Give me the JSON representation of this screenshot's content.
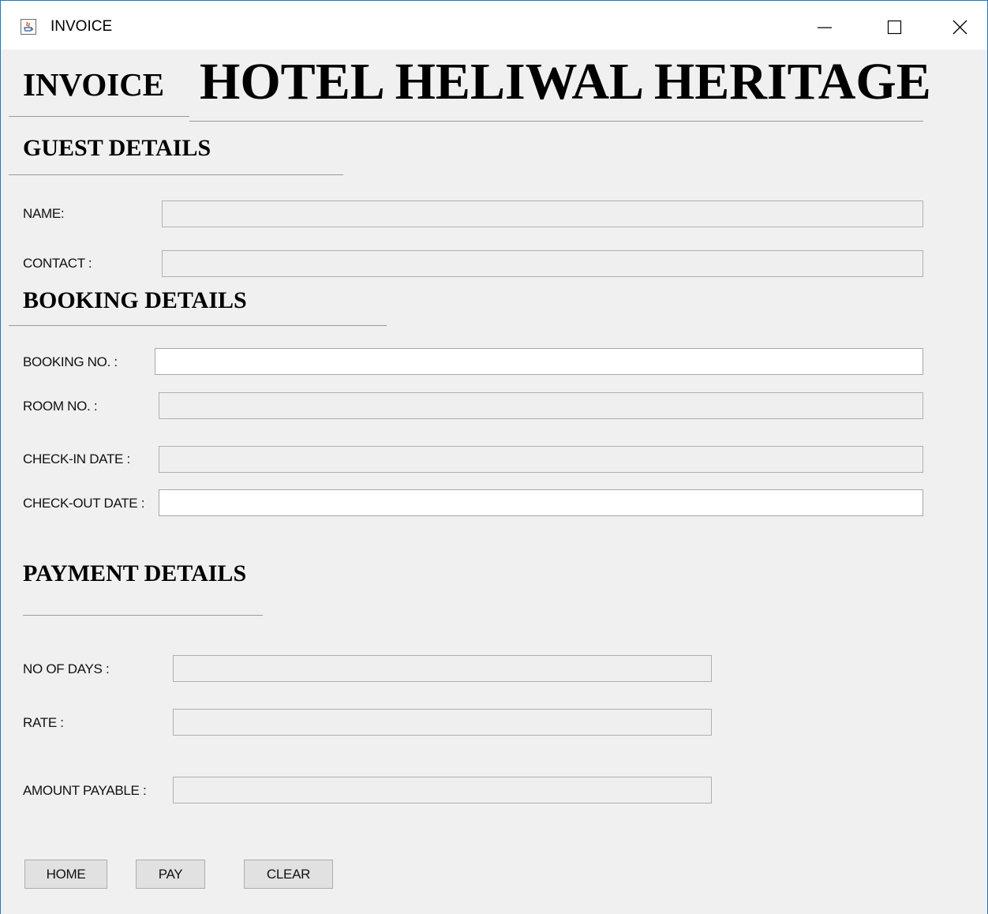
{
  "window": {
    "title": "INVOICE",
    "icon": "java-app-icon",
    "controls": [
      "minimize-icon",
      "maximize-icon",
      "close-icon"
    ]
  },
  "header": {
    "invoice_title": "INVOICE",
    "hotel_name": "HOTEL HELIWAL HERITAGE"
  },
  "guest": {
    "heading": "GUEST DETAILS",
    "name_label": "NAME:",
    "name_value": "",
    "contact_label": "CONTACT :",
    "contact_value": ""
  },
  "booking": {
    "heading": "BOOKING DETAILS",
    "booking_no_label": "BOOKING NO. :",
    "booking_no_value": "",
    "room_no_label": "ROOM NO. :",
    "room_no_value": "",
    "checkin_label": "CHECK-IN DATE :",
    "checkin_value": "",
    "checkout_label": "CHECK-OUT DATE :",
    "checkout_value": ""
  },
  "payment": {
    "heading": "PAYMENT DETAILS",
    "days_label": "NO OF DAYS :",
    "days_value": "",
    "rate_label": "RATE :",
    "rate_value": "",
    "amount_label": "AMOUNT PAYABLE :",
    "amount_value": ""
  },
  "buttons": {
    "home": "HOME",
    "pay": "PAY",
    "clear": "CLEAR"
  },
  "colors": {
    "window_border": "#1979ca",
    "background": "#f0f0f0",
    "titlebar": "#ffffff"
  }
}
